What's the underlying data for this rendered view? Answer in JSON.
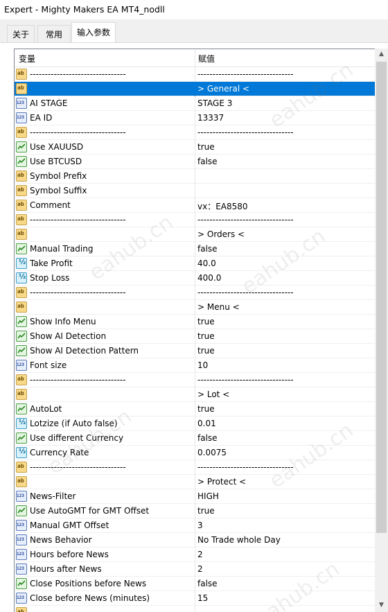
{
  "window": {
    "title": "Expert - Mighty Makers EA MT4_nodll"
  },
  "tabs": [
    {
      "label": "关于"
    },
    {
      "label": "常用"
    },
    {
      "label": "输入参数"
    }
  ],
  "grid": {
    "col_variable": "变量",
    "col_value": "赋值",
    "rows": [
      {
        "type": "string",
        "name": "--------------------------------",
        "value": "--------------------------------"
      },
      {
        "type": "string",
        "name": "",
        "value": " > General <",
        "selected": true
      },
      {
        "type": "int",
        "name": "AI STAGE",
        "value": "STAGE 3"
      },
      {
        "type": "int",
        "name": "EA ID",
        "value": "13337"
      },
      {
        "type": "string",
        "name": "--------------------------------",
        "value": "--------------------------------"
      },
      {
        "type": "bool",
        "name": "Use XAUUSD",
        "value": "true"
      },
      {
        "type": "bool",
        "name": "Use BTCUSD",
        "value": "false"
      },
      {
        "type": "string",
        "name": "Symbol Prefix",
        "value": ""
      },
      {
        "type": "string",
        "name": "Symbol Suffix",
        "value": ""
      },
      {
        "type": "string",
        "name": "Comment",
        "value": "vx：EA8580"
      },
      {
        "type": "string",
        "name": "--------------------------------",
        "value": "--------------------------------"
      },
      {
        "type": "string",
        "name": "",
        "value": " > Orders <"
      },
      {
        "type": "bool",
        "name": "Manual Trading",
        "value": "false"
      },
      {
        "type": "double",
        "name": "Take Profit",
        "value": "40.0"
      },
      {
        "type": "double",
        "name": "Stop Loss",
        "value": "400.0"
      },
      {
        "type": "string",
        "name": "--------------------------------",
        "value": "--------------------------------"
      },
      {
        "type": "string",
        "name": "",
        "value": " > Menu <"
      },
      {
        "type": "bool",
        "name": "Show Info Menu",
        "value": "true"
      },
      {
        "type": "bool",
        "name": "Show AI Detection",
        "value": "true"
      },
      {
        "type": "bool",
        "name": "Show AI Detection Pattern",
        "value": "true"
      },
      {
        "type": "int",
        "name": "Font size",
        "value": "10"
      },
      {
        "type": "string",
        "name": "--------------------------------",
        "value": "--------------------------------"
      },
      {
        "type": "string",
        "name": "",
        "value": " > Lot <"
      },
      {
        "type": "bool",
        "name": "AutoLot",
        "value": "true"
      },
      {
        "type": "double",
        "name": "Lotzize (if Auto false)",
        "value": "0.01"
      },
      {
        "type": "bool",
        "name": "Use different Currency",
        "value": "false"
      },
      {
        "type": "double",
        "name": "Currency Rate",
        "value": "0.0075"
      },
      {
        "type": "string",
        "name": "--------------------------------",
        "value": "--------------------------------"
      },
      {
        "type": "string",
        "name": "",
        "value": " > Protect <"
      },
      {
        "type": "int",
        "name": "News-Filter",
        "value": "HIGH"
      },
      {
        "type": "bool",
        "name": "Use AutoGMT for GMT Offset",
        "value": "true"
      },
      {
        "type": "int",
        "name": "Manual GMT Offset",
        "value": "3"
      },
      {
        "type": "int",
        "name": "News Behavior",
        "value": "No Trade whole Day"
      },
      {
        "type": "int",
        "name": "Hours before News",
        "value": "2"
      },
      {
        "type": "int",
        "name": "Hours after News",
        "value": "2"
      },
      {
        "type": "bool",
        "name": "Close Positions before News",
        "value": "false"
      },
      {
        "type": "int",
        "name": "Close before News (minutes)",
        "value": "15"
      },
      {
        "type": "string",
        "name": "",
        "value": ""
      }
    ]
  },
  "watermark": "eahub.cn",
  "colors": {
    "selection": "#0078d7",
    "grid_border": "#828790"
  }
}
